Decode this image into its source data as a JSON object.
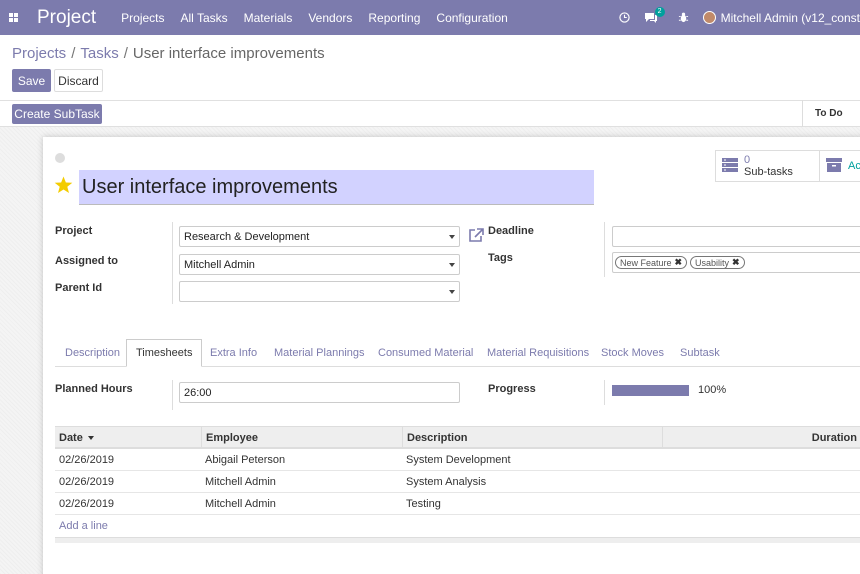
{
  "app": {
    "name": "Project"
  },
  "navbar": {
    "menu": [
      "Projects",
      "All Tasks",
      "Materials",
      "Vendors",
      "Reporting",
      "Configuration"
    ],
    "messages_count": "2",
    "user_name": "Mitchell Admin (v12_const"
  },
  "breadcrumb": {
    "root": "Projects",
    "parent": "Tasks",
    "current": "User interface improvements",
    "separator": "/"
  },
  "buttons": {
    "save": "Save",
    "discard": "Discard",
    "create_subtask": "Create SubTask"
  },
  "statusbar": {
    "stage": "To Do"
  },
  "smart_buttons": {
    "subtasks_count": "0",
    "subtasks_label": "Sub-tasks",
    "active_label": "Ac"
  },
  "task": {
    "title": "User interface improvements",
    "starred": true,
    "fields": {
      "project_label": "Project",
      "project_value": "Research & Development",
      "assigned_label": "Assigned to",
      "assigned_value": "Mitchell Admin",
      "parent_label": "Parent Id",
      "parent_value": "",
      "deadline_label": "Deadline",
      "deadline_value": "",
      "tags_label": "Tags"
    },
    "tags": [
      "New Feature",
      "Usability"
    ]
  },
  "tabs": [
    "Description",
    "Timesheets",
    "Extra Info",
    "Material Plannings",
    "Consumed Material",
    "Material Requisitions",
    "Stock Moves",
    "Subtask"
  ],
  "active_tab": "Timesheets",
  "timesheets": {
    "planned_label": "Planned Hours",
    "planned_value": "26:00",
    "progress_label": "Progress",
    "progress_value": 1.0,
    "progress_text": "100%",
    "columns": [
      "Date",
      "Employee",
      "Description",
      "Duration"
    ],
    "rows": [
      {
        "date": "02/26/2019",
        "employee": "Abigail Peterson",
        "description": "System Development"
      },
      {
        "date": "02/26/2019",
        "employee": "Mitchell Admin",
        "description": "System Analysis"
      },
      {
        "date": "02/26/2019",
        "employee": "Mitchell Admin",
        "description": "Testing"
      }
    ],
    "add_line": "Add a line"
  },
  "colors": {
    "brand": "#7c7bad",
    "title_bg": "#d2d2ff",
    "star": "#f3cc00",
    "badge": "#00a09d"
  }
}
